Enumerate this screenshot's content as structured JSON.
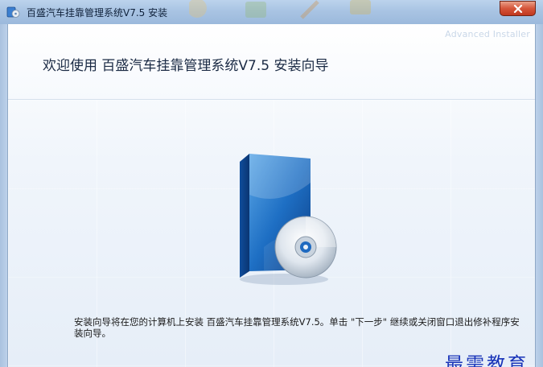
{
  "window": {
    "title": "百盛汽车挂靠管理系统V7.5 安装",
    "close_glyph": "x"
  },
  "header": {
    "vendor_watermark": "Advanced Installer",
    "welcome_text": "欢迎使用 百盛汽车挂靠管理系统V7.5 安装向导"
  },
  "body": {
    "description": "安装向导将在您的计算机上安装 百盛汽车挂靠管理系统V7.5。单击 \"下一步\" 继续或关闭窗口退出修补程序安装向导。"
  },
  "overlay": {
    "brand_mark": "最需教育"
  },
  "icons": {
    "app": "installer-app-icon",
    "product": "software-box-with-cd-icon",
    "close": "close-icon"
  },
  "colors": {
    "titlebar": "#a9c4e3",
    "close_button": "#d5553a",
    "brand_mark": "#1732b8"
  }
}
